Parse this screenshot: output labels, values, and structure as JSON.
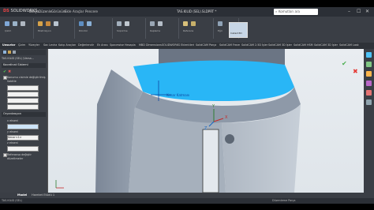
{
  "app": {
    "logo": "DS",
    "logo_text": "SOLIDWORKS",
    "menus": [
      "Dosya",
      "Düzenle",
      "Görünüm",
      "Ekle",
      "Araçlar",
      "Pencere"
    ],
    "document_title": "TAS.KILID (SEL).SLDPRT *",
    "search_placeholder": "Komutları ara",
    "window_controls": [
      "–",
      "☐",
      "✕"
    ]
  },
  "ribbon": {
    "groups": [
      {
        "label": "Çizim"
      },
      {
        "label": "Ekstrüzyon"
      },
      {
        "label": "Döndür"
      },
      {
        "label": "Süpürme"
      },
      {
        "label": "Kaplama"
      },
      {
        "label": "Referans"
      },
      {
        "label": "Eğri"
      }
    ],
    "instant3d_label": "Instant3D"
  },
  "tabs": {
    "items": [
      "Unsurlar",
      "Çizim",
      "Yüzeyler",
      "Sac Levha",
      "Kalıp Araçları",
      "Değerlendir",
      "Ek Arası",
      "Spacewise",
      "Hesapla",
      "MBD Dimensions",
      "SOLIDWORKS Eklentileri",
      "SolidCAM Parça",
      "SolidCAM Freze",
      "SolidCAM 2.5D İşler",
      "SolidCAM 3D İşler",
      "SolidCAM HSM",
      "SolidCAM 3D İşler",
      "SolidCAM Lask"
    ],
    "active_index": 0
  },
  "left_panel": {
    "breadcrumb": "TAS.KILID (SEL) (Varsa…",
    "panel_title": "Koordinat Sistemi",
    "check_label_1": "Konumu cisimle değiştirilmiş",
    "check_label_2": "Sabitle",
    "section_title": "Oryantasyon",
    "x_label": "x ekseni",
    "y_label": "y ekseni",
    "z_label": "z ekseni",
    "z_field_value": "Kenar<1>",
    "bottom_check_1": "Referansa değiştir",
    "bottom_check_2": "düzeltmeler"
  },
  "viewport": {
    "part_label": "Kenar Katmanı",
    "axis_x": "X",
    "axis_y": "Y",
    "axis_z": "Z"
  },
  "bottom_tabs": {
    "items": [
      "Model",
      "Hareket Etüdü 1"
    ],
    "active_index": 0
  },
  "status": {
    "left": "TAS.KILID (SEL)",
    "right": "Düzenleme Parça"
  },
  "colors": {
    "accent_cyan": "#29b6f6",
    "part_gray": "#9aa4b2",
    "toolbar_bg": "#3a3e45"
  }
}
